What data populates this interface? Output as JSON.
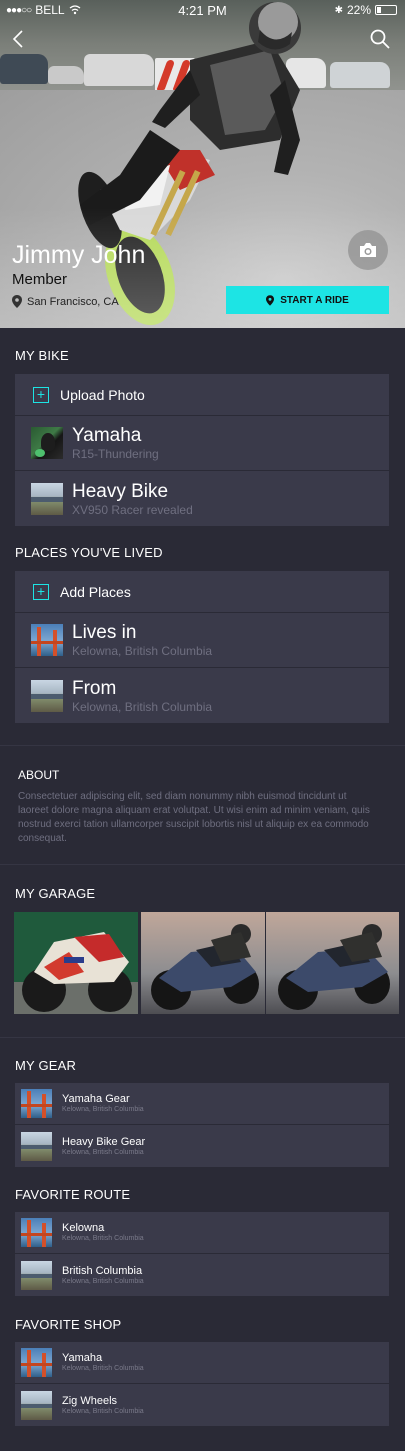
{
  "status": {
    "carrier": "BELL",
    "time": "4:21 PM",
    "battery": "22%"
  },
  "profile": {
    "name": "Jimmy John",
    "role": "Member",
    "location": "San Francisco, CA",
    "ride_button": "START A RIDE"
  },
  "my_bike": {
    "title": "MY BIKE",
    "add_label": "Upload Photo",
    "items": [
      {
        "title": "Yamaha",
        "subtitle": "R15-Thundering"
      },
      {
        "title": "Heavy Bike",
        "subtitle": "XV950 Racer revealed"
      }
    ]
  },
  "places": {
    "title": "PLACES YOU'VE LIVED",
    "add_label": "Add Places",
    "items": [
      {
        "title": "Lives in",
        "subtitle": "Kelowna, British Columbia"
      },
      {
        "title": "From",
        "subtitle": "Kelowna, British Columbia"
      }
    ]
  },
  "about": {
    "title": "ABOUT",
    "text": "Consectetuer adipiscing elit, sed diam nonummy nibh euismod tincidunt ut laoreet dolore magna aliquam erat volutpat. Ut wisi enim ad minim veniam, quis nostrud exerci tation ullamcorper suscipit lobortis nisl ut aliquip ex ea commodo consequat."
  },
  "garage": {
    "title": "MY GARAGE"
  },
  "gear": {
    "title": "MY GEAR",
    "items": [
      {
        "title": "Yamaha Gear",
        "subtitle": "Kelowna, British Columbia"
      },
      {
        "title": "Heavy Bike Gear",
        "subtitle": "Kelowna, British Columbia"
      }
    ]
  },
  "route": {
    "title": "FAVORITE ROUTE",
    "items": [
      {
        "title": "Kelowna",
        "subtitle": "Kelowna, British Columbia"
      },
      {
        "title": "British Columbia",
        "subtitle": "Kelowna, British Columbia"
      }
    ]
  },
  "shop": {
    "title": "FAVORITE SHOP",
    "items": [
      {
        "title": "Yamaha",
        "subtitle": "Kelowna, British Columbia"
      },
      {
        "title": "Zig Wheels",
        "subtitle": "Kelowna, British Columbia"
      }
    ]
  },
  "colors": {
    "accent": "#1de4e4",
    "background": "#2a2a36",
    "card": "#3a3a4a",
    "muted_text": "#6f6f80"
  }
}
